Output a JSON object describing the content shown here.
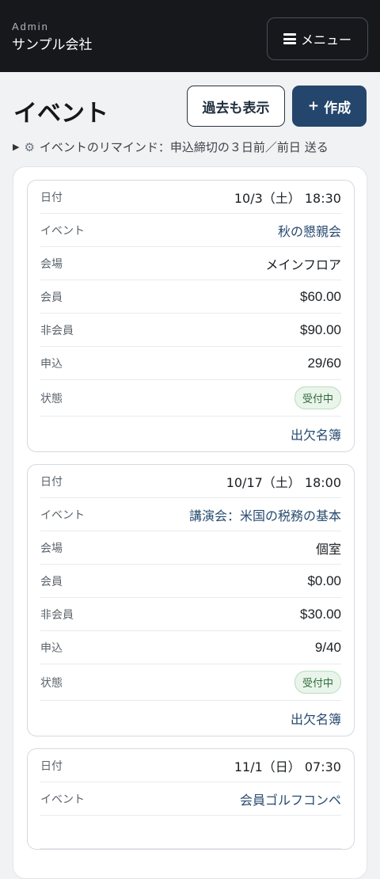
{
  "header": {
    "subtitle": "Admin",
    "org_name": "サンプル会社",
    "menu_label": "メニュー"
  },
  "page": {
    "title": "イベント",
    "show_past_label": "過去も表示",
    "create_label": "作成",
    "reminder_text": "イベントのリマインド：申込締切の３日前／前日 送る"
  },
  "labels": {
    "date": "日付",
    "event": "イベント",
    "venue": "会場",
    "member": "会員",
    "non_member": "非会員",
    "applications": "申込",
    "status": "状態"
  },
  "events": [
    {
      "date": "10/3（土） 18:30",
      "name": "秋の懇親会",
      "venue": "メインフロア",
      "member_fee": "$60.00",
      "non_member_fee": "$90.00",
      "applications": "29/60",
      "status": "受付中",
      "attendance_link": "出欠名簿"
    },
    {
      "date": "10/17（土） 18:00",
      "name": "講演会：米国の税務の基本",
      "venue": "個室",
      "member_fee": "$0.00",
      "non_member_fee": "$30.00",
      "applications": "9/40",
      "status": "受付中",
      "attendance_link": "出欠名簿"
    },
    {
      "date": "11/1（日） 07:30",
      "name": "会員ゴルフコンペ"
    }
  ],
  "colors": {
    "header_bg": "#16181c",
    "primary": "#24466c",
    "link": "#274b70",
    "status_open": "#2f6b3a"
  }
}
